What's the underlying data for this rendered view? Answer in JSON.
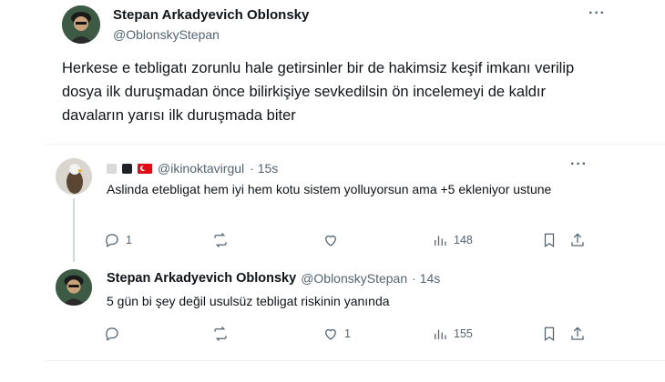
{
  "main_tweet": {
    "author_name": "Stepan Arkadyevich Oblonsky",
    "handle": "@OblonskyStepan",
    "text": "Herkese e tebligatı zorunlu hale getirsinler bir de hakimsiz keşif imkanı verilip dosya ilk duruşmadan önce bilirkişiye sevkedilsin ön incelemeyi de kaldır davaların yarısı ilk duruşmada biter",
    "more_icon": "more-icon"
  },
  "reply1": {
    "handle": "@ikinoktavirgul",
    "time": "· 15s",
    "text": "Aslinda etebligat hem iyi hem kotu sistem yolluyorsun ama +5 ekleniyor ustune",
    "reply_count": "1",
    "retweet_count": "",
    "like_count": "",
    "views": "148",
    "colors": {
      "flag": "#e30a17",
      "badge_dark": "#1f2328",
      "badge_light": "#d9d9d9"
    }
  },
  "reply2": {
    "author_name": "Stepan Arkadyevich Oblonsky",
    "handle": "@OblonskyStepan",
    "time": "· 14s",
    "text": "5 gün bi şey değil usulsüz tebligat riskinin yanında",
    "reply_count": "",
    "retweet_count": "",
    "like_count": "1",
    "views": "155"
  }
}
